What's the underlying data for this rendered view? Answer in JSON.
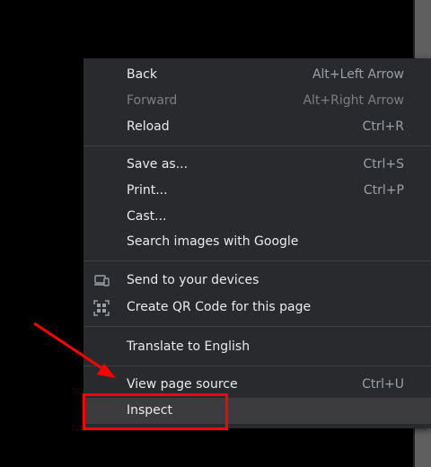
{
  "menu": {
    "items": [
      {
        "label": "Back",
        "shortcut": "Alt+Left Arrow"
      },
      {
        "label": "Forward",
        "shortcut": "Alt+Right Arrow"
      },
      {
        "label": "Reload",
        "shortcut": "Ctrl+R"
      },
      {
        "label": "Save as...",
        "shortcut": "Ctrl+S"
      },
      {
        "label": "Print...",
        "shortcut": "Ctrl+P"
      },
      {
        "label": "Cast...",
        "shortcut": ""
      },
      {
        "label": "Search images with Google",
        "shortcut": ""
      },
      {
        "label": "Send to your devices",
        "icon": "devices-icon"
      },
      {
        "label": "Create QR Code for this page",
        "icon": "qr-code-icon"
      },
      {
        "label": "Translate to English",
        "shortcut": ""
      },
      {
        "label": "View page source",
        "shortcut": "Ctrl+U"
      },
      {
        "label": "Inspect",
        "shortcut": ""
      }
    ]
  },
  "annotations": {
    "highlight_color": "#ff0000",
    "arrow_color": "#ff0000"
  },
  "colors": {
    "menu_bg": "#292a2d",
    "text": "#e8eaed",
    "shortcut": "#9aa0a6",
    "disabled": "#7b7e82",
    "hover": "#3c3c3f"
  }
}
